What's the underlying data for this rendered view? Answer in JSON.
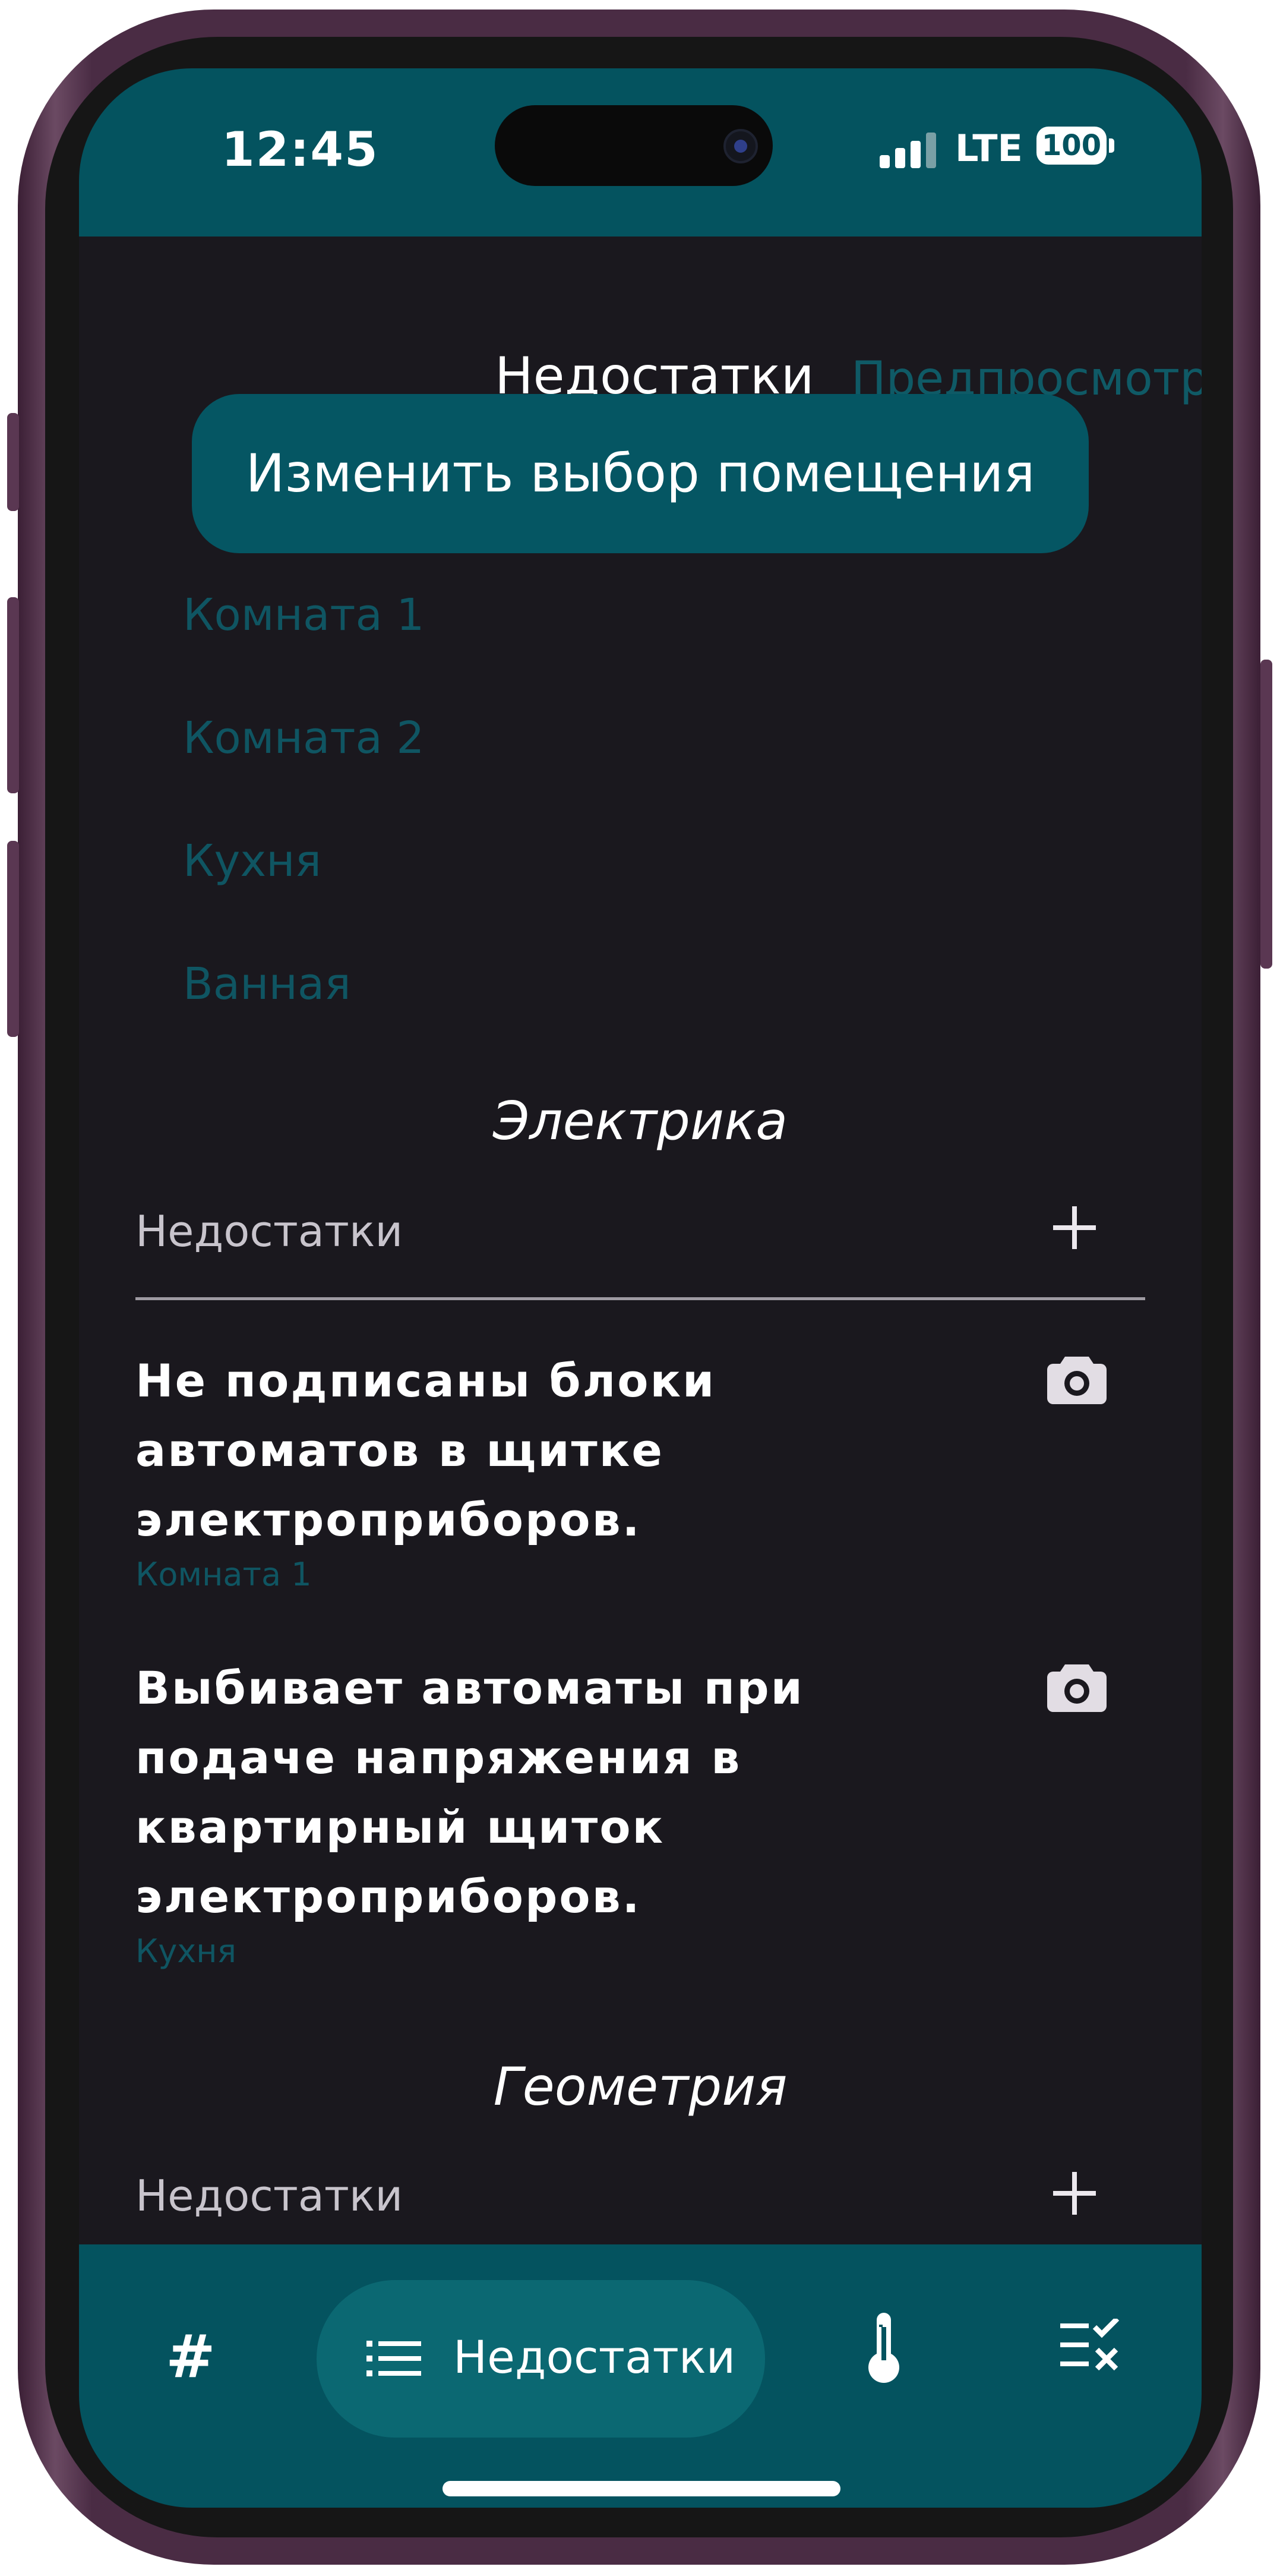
{
  "status_bar": {
    "time": "12:45",
    "network": "LTE",
    "battery": "100"
  },
  "header": {
    "title": "Недостатки",
    "preview_label": "Предпросмотр"
  },
  "change_room_button": "Изменить выбор помещения",
  "rooms": [
    "Комната 1",
    "Комната 2",
    "Кухня",
    "Ванная"
  ],
  "sections": [
    {
      "title": "Электрика",
      "row_label": "Недостатки",
      "defects": [
        {
          "text": "Не подписаны блоки автоматов в щитке электроприборов.",
          "room": "Комната 1"
        },
        {
          "text": "Выбивает автоматы при подаче напряжения в квартирный щиток электроприборов.",
          "room": "Кухня"
        }
      ]
    },
    {
      "title": "Геометрия",
      "row_label": "Недостатки",
      "defects": []
    }
  ],
  "bottom_nav": {
    "hash_label": "#",
    "active_label": "Недостатки",
    "icons": [
      "hash-icon",
      "list-icon",
      "thermometer-icon",
      "checklist-icon"
    ]
  },
  "colors": {
    "accent": "#04535f",
    "background": "#1a181e",
    "room_text": "#0f5562"
  }
}
